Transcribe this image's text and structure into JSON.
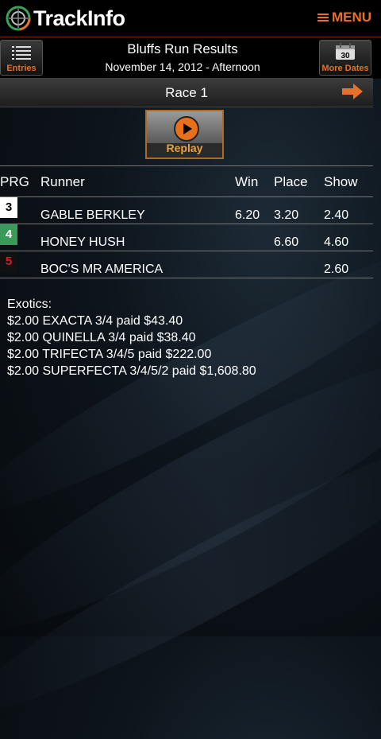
{
  "header": {
    "brand": "TrackInfo",
    "menu_label": "MENU"
  },
  "subheader": {
    "entries_label": "Entries",
    "title": "Bluffs Run Results",
    "date": "November 14, 2012 - Afternoon",
    "more_dates_label": "More Dates",
    "calendar_day": "30"
  },
  "race": {
    "name": "Race 1"
  },
  "replay": {
    "label": "Replay"
  },
  "results": {
    "columns": [
      "PRG",
      "Runner",
      "Win",
      "Place",
      "Show"
    ],
    "rows": [
      {
        "prg": "3",
        "runner": "GABLE BERKLEY",
        "win": "6.20",
        "place": "3.20",
        "show": "2.40",
        "bg": "#ffffff",
        "fg": "#000000"
      },
      {
        "prg": "4",
        "runner": "HONEY HUSH",
        "win": "",
        "place": "6.60",
        "show": "4.60",
        "bg": "#3a9a5a",
        "fg": "#ffffff"
      },
      {
        "prg": "5",
        "runner": "BOC'S MR AMERICA",
        "win": "",
        "place": "",
        "show": "2.60",
        "bg": "#111111",
        "fg": "#d02020"
      }
    ]
  },
  "exotics": {
    "heading": "Exotics:",
    "lines": [
      "$2.00 EXACTA 3/4 paid $43.40",
      "$2.00 QUINELLA 3/4 paid $38.40",
      "$2.00 TRIFECTA 3/4/5 paid $222.00",
      "$2.00 SUPERFECTA 3/4/5/2 paid $1,608.80"
    ]
  },
  "colors": {
    "accent": "#e8702a"
  }
}
